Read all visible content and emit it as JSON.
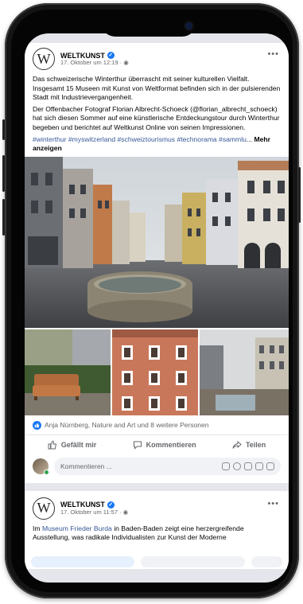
{
  "post1": {
    "page_name": "WELTKUNST",
    "avatar_letter": "W",
    "timestamp": "17. Oktober um 12:19 · ",
    "paragraph1": "Das schweizerische Winterthur überrascht mit seiner kulturellen Vielfalt. Insgesamt 15 Museen mit Kunst von Weltformat befinden sich in der pulsierenden Stadt mit Industrievergangenheit.",
    "paragraph2": "Der Offenbacher Fotograf Florian Albrecht-Schoeck (@florian_albrecht_schoeck) hat sich diesen Sommer auf eine künstlerische Entdeckungstour durch Winterthur begeben und berichtet auf Weltkunst Online von seinen Impressionen.",
    "hashtags": "#winterthur #myswitzerland #schweiztourismus #technorama #sammlu",
    "ellipsis": "... ",
    "see_more": "Mehr anzeigen",
    "reactions_text": "Anja Nürnberg, Nature and Art und 8 weitere Personen",
    "like_label": "Gefällt mir",
    "comment_label": "Kommentieren",
    "share_label": "Teilen",
    "comment_placeholder": "Kommentieren ..."
  },
  "post2": {
    "page_name": "WELTKUNST",
    "avatar_letter": "W",
    "timestamp": "17. Oktober um 11:57 · ",
    "text_before": "Im ",
    "link_text": "Museum Frieder Burda",
    "text_after": " in Baden-Baden zeigt eine herzergreifende Ausstellung, was radikale Individualisten zur Kunst der Moderne"
  },
  "colors": {
    "facebook_blue": "#1877f2",
    "link": "#385898",
    "secondary_text": "#65676b",
    "feed_bg": "#e4e6eb"
  },
  "icons": [
    "verified-badge-icon",
    "more-options-icon",
    "globe-icon",
    "like-reaction-icon",
    "thumbs-up-icon",
    "comment-icon",
    "share-icon",
    "emoji-icon",
    "camera-icon",
    "gif-icon",
    "sticker-icon"
  ]
}
